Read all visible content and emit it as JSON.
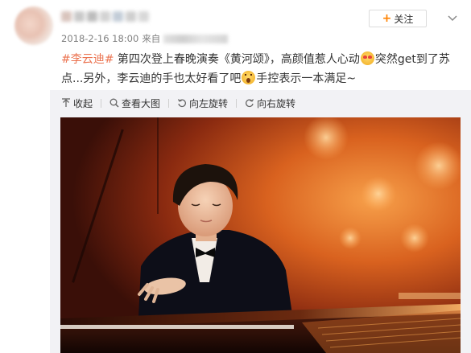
{
  "post": {
    "timestamp": "2018-2-16 18:00",
    "source_prefix": "来自",
    "follow_label": "关注",
    "follow_plus": "+",
    "text_topic": "#李云迪#",
    "text_part1": " 第四次登上春晚演奏《黄河颂》，高颜值惹人心动",
    "text_part2": "突然get到了苏点...另外，李云迪的手也太好看了吧",
    "text_part3": "手控表示一本满足~",
    "emojis": [
      "love-face-emoji",
      "shocked-face-emoji"
    ]
  },
  "toolbar": {
    "collapse_label": "收起",
    "view_large_label": "查看大图",
    "rotate_left_label": "向左旋转",
    "rotate_right_label": "向右旋转"
  },
  "colors": {
    "topic": "#eb7350",
    "follow_plus": "#ff8200",
    "meta_text": "#808080",
    "panel_bg": "#f2f2f5",
    "stage_glow": "#e8832a"
  },
  "icons": [
    "collapse-arrow-icon",
    "magnifier-icon",
    "rotate-left-icon",
    "rotate-right-icon",
    "chevron-down-icon",
    "plus-icon"
  ]
}
